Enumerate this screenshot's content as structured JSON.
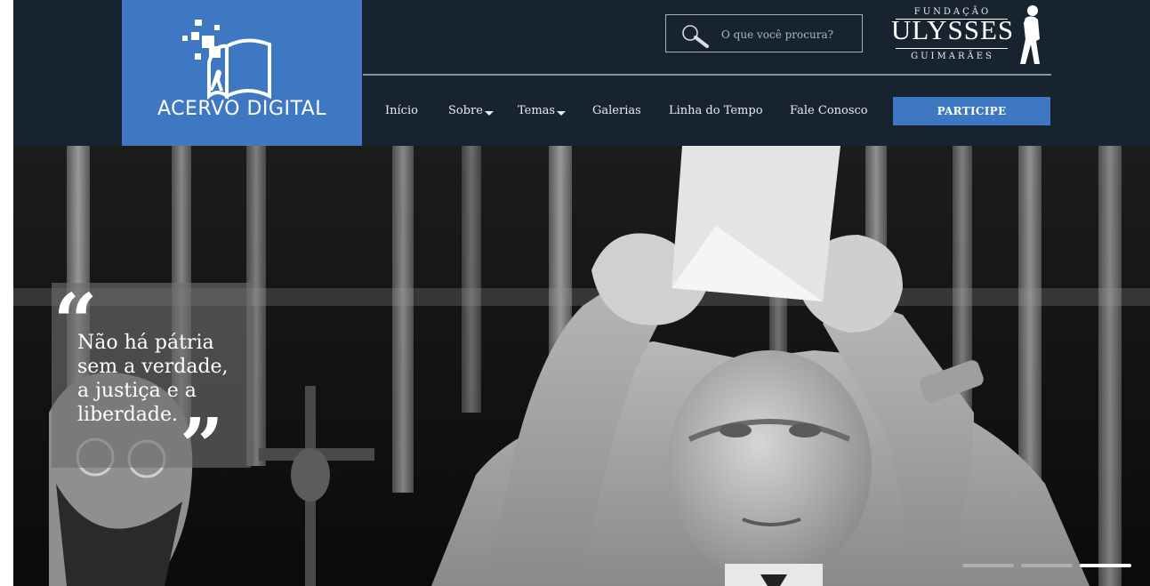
{
  "header": {
    "logo_text": "ACERVO DIGITAL",
    "search": {
      "placeholder": "O que você procura?"
    },
    "foundation_logo": {
      "top": "FUNDAÇÃO",
      "main": "ULYSSES",
      "bottom": "GUIMARÃES"
    },
    "nav": [
      {
        "label": "Início",
        "dropdown": false
      },
      {
        "label": "Sobre",
        "dropdown": true
      },
      {
        "label": "Temas",
        "dropdown": true
      },
      {
        "label": "Galerias",
        "dropdown": false
      },
      {
        "label": "Linha do Tempo",
        "dropdown": false
      },
      {
        "label": "Fale Conosco",
        "dropdown": false
      }
    ],
    "cta_label": "PARTICIPE"
  },
  "hero": {
    "quote_open": "“",
    "quote_lines": [
      "Não há pátria",
      "sem a verdade,",
      "a justiça e a",
      "liberdade."
    ],
    "quote_close": "”",
    "slider": {
      "slides": 3,
      "active": 3
    }
  },
  "colors": {
    "header_bg": "#17232e",
    "brand_blue": "#3f78c2",
    "text_light": "#e8ecef"
  }
}
